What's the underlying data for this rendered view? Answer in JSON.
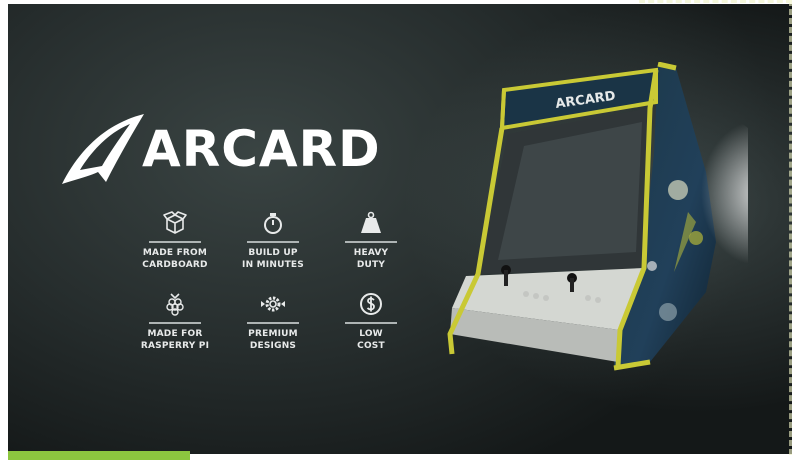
{
  "brand": {
    "name": "ARCARD",
    "accent": "#8cc63f",
    "frame_color": "#c9c935"
  },
  "features": [
    {
      "icon": "box-icon",
      "label": "MADE FROM\nCARDBOARD"
    },
    {
      "icon": "stopwatch-icon",
      "label": "BUILD UP\nIN MINUTES"
    },
    {
      "icon": "weight-icon",
      "label": "HEAVY\nDUTY"
    },
    {
      "icon": "raspberry-icon",
      "label": "MADE FOR\nRASPERRY PI"
    },
    {
      "icon": "gear-icon",
      "label": "PREMIUM\nDESIGNS"
    },
    {
      "icon": "dollar-icon",
      "label": "LOW\nCOST"
    }
  ],
  "cabinet": {
    "marquee_text": "ARCARD"
  }
}
